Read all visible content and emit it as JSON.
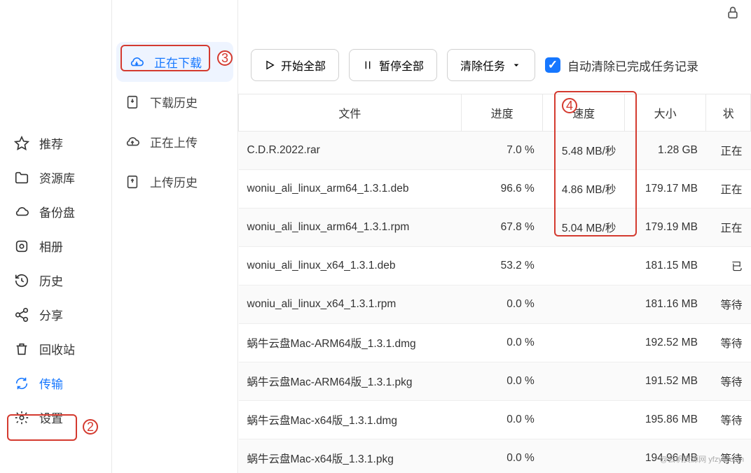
{
  "nav": {
    "recommend": "推荐",
    "resource": "资源库",
    "backup": "备份盘",
    "album": "相册",
    "history": "历史",
    "share": "分享",
    "recycle": "回收站",
    "transfer": "传输",
    "settings": "设置"
  },
  "subnav": {
    "downloading": "正在下载",
    "downloadHistory": "下载历史",
    "uploading": "正在上传",
    "uploadHistory": "上传历史"
  },
  "toolbar": {
    "startAll": "开始全部",
    "pauseAll": "暂停全部",
    "clearTasks": "清除任务",
    "autoClear": "自动清除已完成任务记录"
  },
  "columns": {
    "file": "文件",
    "progress": "进度",
    "speed": "速度",
    "size": "大小",
    "status": "状"
  },
  "markers": {
    "m2": "2",
    "m3": "3",
    "m4": "4"
  },
  "rows": [
    {
      "file": "C.D.R.2022.rar",
      "progress": "7.0 %",
      "speed": "5.48 MB/秒",
      "size": "1.28 GB",
      "status": "正在"
    },
    {
      "file": "woniu_ali_linux_arm64_1.3.1.deb",
      "progress": "96.6 %",
      "speed": "4.86 MB/秒",
      "size": "179.17 MB",
      "status": "正在"
    },
    {
      "file": "woniu_ali_linux_arm64_1.3.1.rpm",
      "progress": "67.8 %",
      "speed": "5.04 MB/秒",
      "size": "179.19 MB",
      "status": "正在"
    },
    {
      "file": "woniu_ali_linux_x64_1.3.1.deb",
      "progress": "53.2 %",
      "speed": "",
      "size": "181.15 MB",
      "status": "已"
    },
    {
      "file": "woniu_ali_linux_x64_1.3.1.rpm",
      "progress": "0.0 %",
      "speed": "",
      "size": "181.16 MB",
      "status": "等待"
    },
    {
      "file": "蜗牛云盘Mac-ARM64版_1.3.1.dmg",
      "progress": "0.0 %",
      "speed": "",
      "size": "192.52 MB",
      "status": "等待"
    },
    {
      "file": "蜗牛云盘Mac-ARM64版_1.3.1.pkg",
      "progress": "0.0 %",
      "speed": "",
      "size": "191.52 MB",
      "status": "等待"
    },
    {
      "file": "蜗牛云盘Mac-x64版_1.3.1.dmg",
      "progress": "0.0 %",
      "speed": "",
      "size": "195.86 MB",
      "status": "等待"
    },
    {
      "file": "蜗牛云盘Mac-x64版_1.3.1.pkg",
      "progress": "0.0 %",
      "speed": "",
      "size": "194.96 MB",
      "status": "等待"
    }
  ],
  "watermark": "@云帆资源网 yfzyw.com"
}
